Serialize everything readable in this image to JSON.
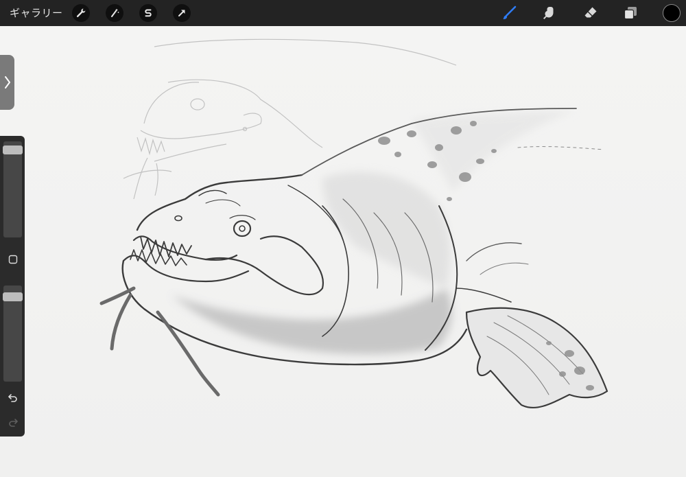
{
  "toolbar": {
    "gallery_label": "ギャラリー",
    "left_tools": [
      {
        "name": "actions",
        "icon": "wrench-icon"
      },
      {
        "name": "adjustments",
        "icon": "magic-wand-icon"
      },
      {
        "name": "selection",
        "icon": "selection-s-icon"
      },
      {
        "name": "transform",
        "icon": "arrow-cursor-icon"
      }
    ],
    "right_tools": [
      {
        "name": "brush",
        "icon": "brush-icon",
        "active": true
      },
      {
        "name": "smudge",
        "icon": "smudge-finger-icon",
        "active": false
      },
      {
        "name": "eraser",
        "icon": "eraser-icon",
        "active": false
      },
      {
        "name": "layers",
        "icon": "layers-icon",
        "active": false
      }
    ],
    "active_color": "#000000",
    "accent_color": "#2f7cf6"
  },
  "sidebar": {
    "brush_size_fraction": 0.95,
    "opacity_fraction": 0.92,
    "modify_button_icon": "square-icon",
    "undo_icon": "undo-icon",
    "redo_icon": "redo-icon"
  },
  "canvas": {
    "artwork": "pencil-sketch-fish-creature"
  }
}
